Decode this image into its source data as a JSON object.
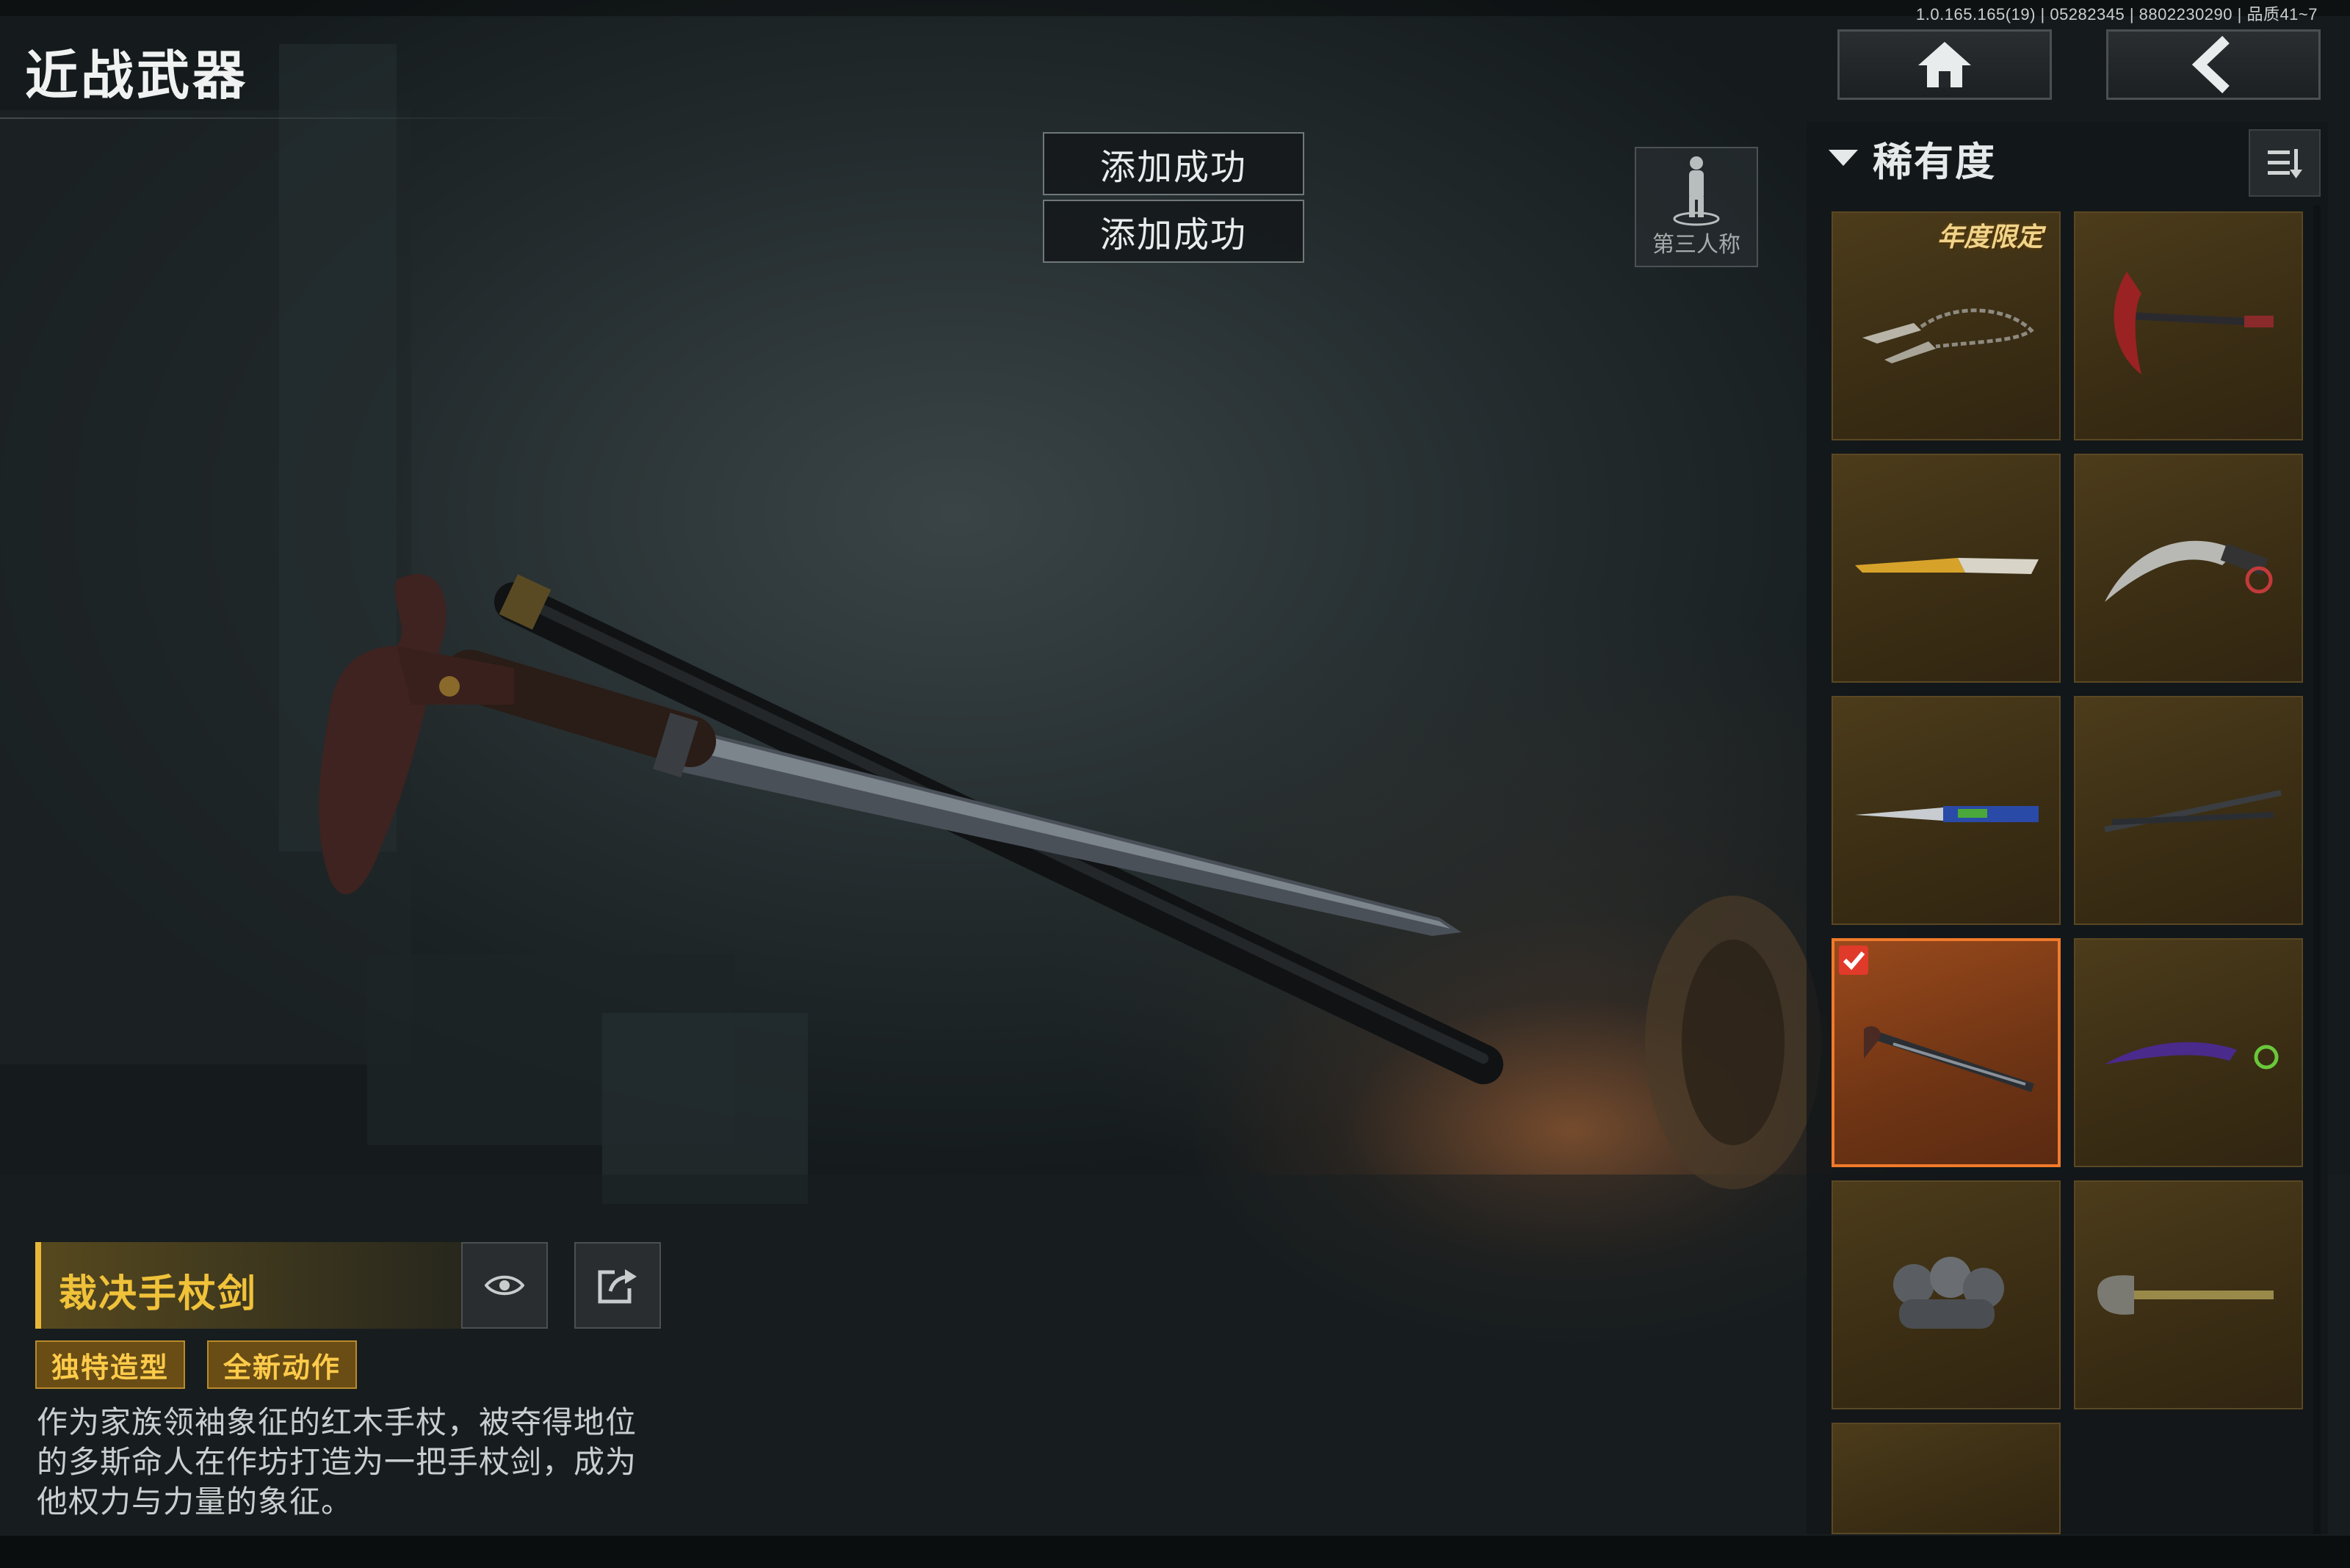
{
  "header": {
    "title": "近战武器",
    "build_info": "1.0.165.165(19) | 05282345 | 8802230290 | 品质41~7"
  },
  "nav": {
    "home_icon": "home-icon",
    "back_icon": "back-chevron-icon"
  },
  "toasts": [
    "添加成功",
    "添加成功"
  ],
  "view_toggle": {
    "label": "第三人称",
    "icon": "third-person-figure-icon"
  },
  "panel": {
    "filter_label": "稀有度",
    "filter_icon": "chevron-down-icon",
    "sort_icon": "sort-icon",
    "items": [
      {
        "name": "chain-dagger",
        "badge": "年度限定",
        "selected": false
      },
      {
        "name": "scythe",
        "badge": "",
        "selected": false
      },
      {
        "name": "golden-knife",
        "badge": "",
        "selected": false
      },
      {
        "name": "karambit",
        "badge": "",
        "selected": false
      },
      {
        "name": "blue-butterfly-knife",
        "badge": "",
        "selected": false
      },
      {
        "name": "twin-blade",
        "badge": "",
        "selected": false
      },
      {
        "name": "cane-sword",
        "badge": "",
        "selected": true
      },
      {
        "name": "purple-karambit",
        "badge": "",
        "selected": false
      },
      {
        "name": "brass-knuckles",
        "badge": "",
        "selected": false
      },
      {
        "name": "shovel",
        "badge": "",
        "selected": false
      },
      {
        "name": "partial-item",
        "badge": "",
        "selected": false
      }
    ]
  },
  "item": {
    "name": "裁决手杖剑",
    "tags": [
      "独特造型",
      "全新动作"
    ],
    "description_lines": [
      "作为家族领袖象征的红木手杖，被夺得地位",
      "的多斯命人在作坊打造为一把手杖剑，成为",
      "他权力与力量的象征。"
    ],
    "preview_icon": "eye-icon",
    "share_icon": "share-icon"
  },
  "colors": {
    "accent": "#f0c23a",
    "selected_border": "#f07a2a",
    "tile": "#3b2e14"
  }
}
